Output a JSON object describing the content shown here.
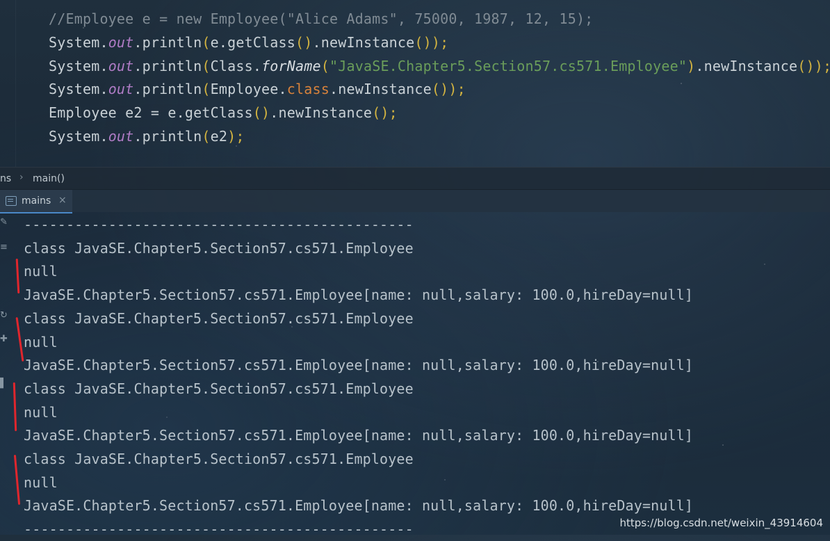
{
  "editor": {
    "lines": [
      [
        {
          "t": "//Employee e = new Employee(\"Alice Adams\", 75000, 1987, 12, 15);",
          "c": "comment"
        }
      ],
      [
        {
          "t": "System.",
          "c": "plain"
        },
        {
          "t": "out",
          "c": "field"
        },
        {
          "t": ".println",
          "c": "plain"
        },
        {
          "t": "(",
          "c": "paren"
        },
        {
          "t": "e.getClass",
          "c": "plain"
        },
        {
          "t": "()",
          "c": "paren"
        },
        {
          "t": ".newInstance",
          "c": "plain"
        },
        {
          "t": "())",
          "c": "paren"
        },
        {
          "t": ";",
          "c": "semi"
        }
      ],
      [
        {
          "t": "System.",
          "c": "plain"
        },
        {
          "t": "out",
          "c": "field"
        },
        {
          "t": ".println",
          "c": "plain"
        },
        {
          "t": "(",
          "c": "paren"
        },
        {
          "t": "Class.",
          "c": "plain"
        },
        {
          "t": "forName",
          "c": "static"
        },
        {
          "t": "(",
          "c": "paren"
        },
        {
          "t": "\"JavaSE.Chapter5.Section57.cs571.Employee\"",
          "c": "string"
        },
        {
          "t": ")",
          "c": "paren"
        },
        {
          "t": ".newInstance",
          "c": "plain"
        },
        {
          "t": "())",
          "c": "paren"
        },
        {
          "t": ";",
          "c": "semi"
        }
      ],
      [
        {
          "t": "System.",
          "c": "plain"
        },
        {
          "t": "out",
          "c": "field"
        },
        {
          "t": ".println",
          "c": "plain"
        },
        {
          "t": "(",
          "c": "paren"
        },
        {
          "t": "Employee.",
          "c": "plain"
        },
        {
          "t": "class",
          "c": "keyword"
        },
        {
          "t": ".newInstance",
          "c": "plain"
        },
        {
          "t": "())",
          "c": "paren"
        },
        {
          "t": ";",
          "c": "semi"
        }
      ],
      [
        {
          "t": "Employee e2 = e.getClass",
          "c": "plain"
        },
        {
          "t": "()",
          "c": "paren"
        },
        {
          "t": ".newInstance",
          "c": "plain"
        },
        {
          "t": "()",
          "c": "paren"
        },
        {
          "t": ";",
          "c": "semi"
        }
      ],
      [
        {
          "t": "System.",
          "c": "plain"
        },
        {
          "t": "out",
          "c": "field"
        },
        {
          "t": ".println",
          "c": "plain"
        },
        {
          "t": "(",
          "c": "paren"
        },
        {
          "t": "e2",
          "c": "plain"
        },
        {
          "t": ")",
          "c": "paren"
        },
        {
          "t": ";",
          "c": "semi"
        }
      ]
    ]
  },
  "breadcrumb": {
    "class_name": "ns",
    "method": "main()"
  },
  "run_tabs": {
    "tab_label": "mains",
    "close_glyph": "×"
  },
  "console": {
    "lines": [
      "----------------------------------------------",
      "class JavaSE.Chapter5.Section57.cs571.Employee",
      "null",
      "JavaSE.Chapter5.Section57.cs571.Employee[name: null,salary: 100.0,hireDay=null]",
      "class JavaSE.Chapter5.Section57.cs571.Employee",
      "null",
      "JavaSE.Chapter5.Section57.cs571.Employee[name: null,salary: 100.0,hireDay=null]",
      "class JavaSE.Chapter5.Section57.cs571.Employee",
      "null",
      "JavaSE.Chapter5.Section57.cs571.Employee[name: null,salary: 100.0,hireDay=null]",
      "class JavaSE.Chapter5.Section57.cs571.Employee",
      "null",
      "JavaSE.Chapter5.Section57.cs571.Employee[name: null,salary: 100.0,hireDay=null]",
      "----------------------------------------------"
    ],
    "side_icons": [
      "pencil-icon",
      "list-icon",
      "rerun-icon",
      "pin-icon",
      "stop-icon"
    ]
  },
  "watermark": "https://blog.csdn.net/weixin_43914604",
  "colors": {
    "annotation_red": "#e0262d",
    "keyword_orange": "#d8823b",
    "field_purple": "#b07cc6",
    "string_green": "#6a9d5a"
  }
}
